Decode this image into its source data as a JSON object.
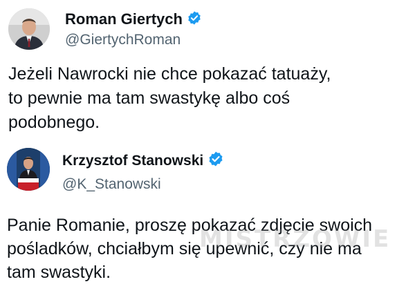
{
  "tweets": [
    {
      "author": {
        "display_name": "Roman Giertych",
        "handle": "@GiertychRoman",
        "verified_icon": "verified-badge-icon"
      },
      "text_lines": [
        "Jeżeli Nawrocki nie chce pokazać tatuaży,",
        "to pewnie ma tam swastykę albo coś",
        "podobnego."
      ]
    },
    {
      "author": {
        "display_name": "Krzysztof Stanowski",
        "handle": "@K_Stanowski",
        "verified_icon": "verified-badge-icon"
      },
      "text_lines": [
        "Panie Romanie, proszę pokazać zdjęcie swoich",
        "pośladków, chciałbym się upewnić, czy nie ma",
        "tam swastyki."
      ]
    }
  ],
  "watermark": "MISTRZOWIE",
  "colors": {
    "text": "#0f1419",
    "handle": "#536471",
    "verified": "#1d9bf0"
  }
}
